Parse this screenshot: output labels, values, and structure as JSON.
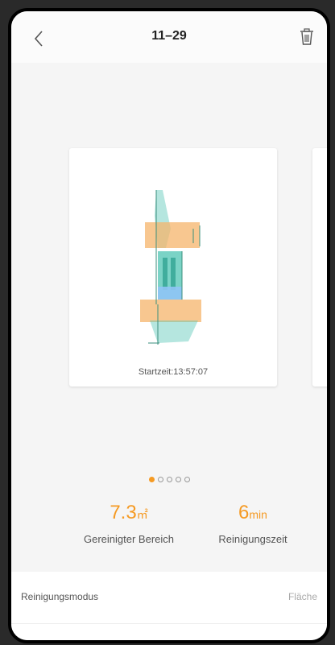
{
  "header": {
    "title": "11–29",
    "back_icon": "chevron-left-icon",
    "delete_icon": "trash-icon"
  },
  "card": {
    "start_time": "Startzeit:13:57:07"
  },
  "carousel": {
    "total": 5,
    "active": 0
  },
  "stats": {
    "area_value": "7.3",
    "area_unit": "㎡",
    "area_label": "Gereinigter Bereich",
    "time_value": "6",
    "time_unit": "min",
    "time_label": "Reinigungszeit"
  },
  "mode": {
    "label": "Reinigungsmodus",
    "value": "Fläche"
  },
  "colors": {
    "accent": "#f59a23",
    "map_teal": "#5ac8b8",
    "map_orange": "#f5b46b",
    "map_blue": "#8fc4f5"
  }
}
